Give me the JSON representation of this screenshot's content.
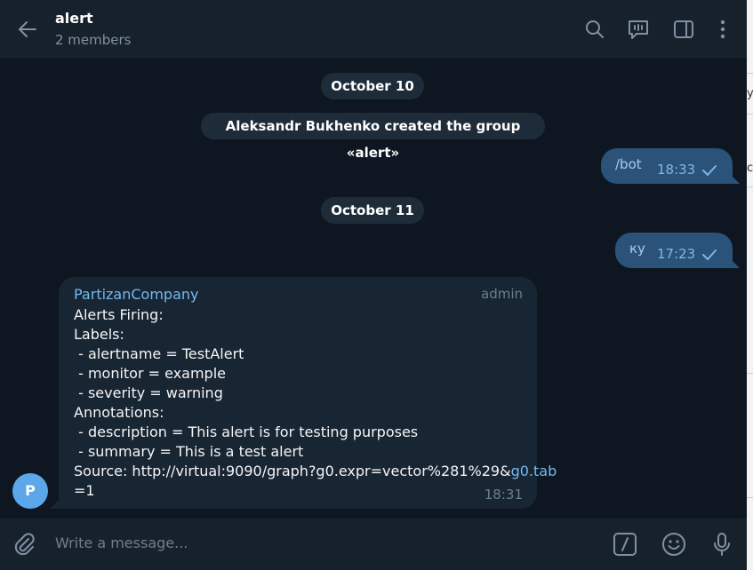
{
  "header": {
    "title": "alert",
    "subtitle": "2 members",
    "icons": [
      "back-arrow-icon",
      "search-icon",
      "live-chat-icon",
      "sidebar-toggle-icon",
      "more-options-icon"
    ]
  },
  "messages": {
    "date1": "October 10",
    "service": "Aleksandr Bukhenko created the group «alert»",
    "out1": {
      "text": "/bot",
      "time": "18:33"
    },
    "date2": "October 11",
    "out2": {
      "text": "ку",
      "time": "17:23"
    },
    "incoming": {
      "sender": "PartizanCompany",
      "role": "admin",
      "lines": [
        "Alerts Firing:",
        "Labels:",
        " - alertname = TestAlert",
        " - monitor = example",
        " - severity = warning",
        "Annotations:",
        " - description = This alert is for testing purposes",
        " - summary = This is a test alert"
      ],
      "source_prefix": "Source: http://virtual:9090/graph?g0.expr=vector%281%29&",
      "source_link": "g0.tab",
      "source_suffix": "=1",
      "time": "18:31",
      "avatar_letter": "P"
    }
  },
  "composer": {
    "placeholder": "Write a message...",
    "icons": [
      "attach-icon",
      "bot-commands-icon",
      "emoji-icon",
      "microphone-icon"
    ]
  },
  "colors": {
    "background": "#0e1621",
    "header": "#17212b",
    "outgoing_bubble": "#2b5278",
    "incoming_bubble": "#182533",
    "accent": "#71baf2"
  }
}
